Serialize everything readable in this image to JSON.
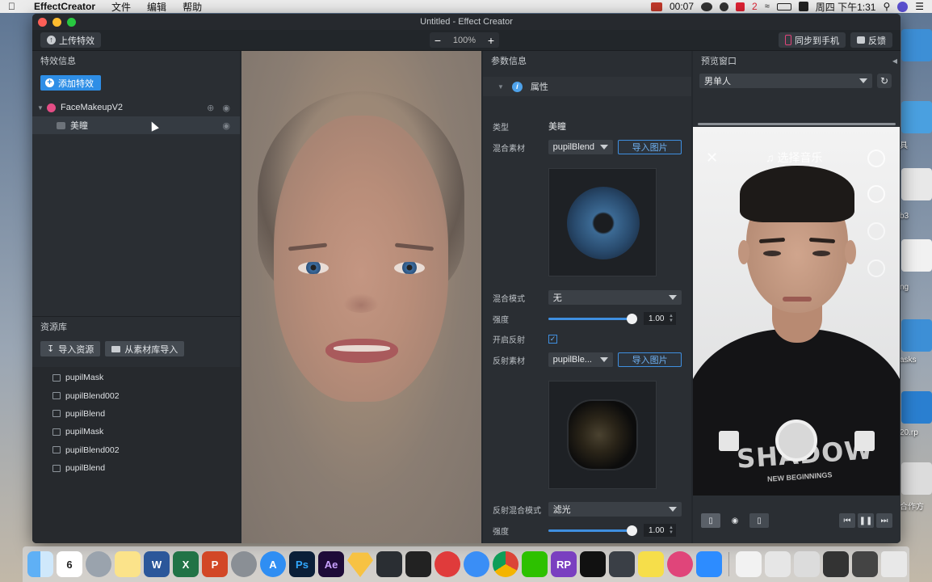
{
  "menubar": {
    "app_name": "EffectCreator",
    "menus": [
      "文件",
      "编辑",
      "帮助"
    ],
    "time": "00:07",
    "badge": "2",
    "datetime": "周四 下午1:31"
  },
  "window": {
    "title": "Untitled - Effect Creator"
  },
  "toolbar": {
    "upload_label": "上传特效",
    "zoom_minus": "−",
    "zoom_value": "100%",
    "zoom_plus": "+",
    "sync_label": "同步到手机",
    "feedback_label": "反馈"
  },
  "effects_panel": {
    "title": "特效信息",
    "add_label": "添加特效",
    "tree": {
      "root_label": "FaceMakeupV2",
      "child_label": "美瞳"
    }
  },
  "resources": {
    "title": "资源库",
    "import_label": "导入资源",
    "library_import_label": "从素材库导入",
    "items": [
      "pupilMask",
      "pupilBlend002",
      "pupilBlend",
      "pupilMask",
      "pupilBlend002",
      "pupilBlend"
    ]
  },
  "params": {
    "title": "参数信息",
    "section_label": "属性",
    "type_label": "类型",
    "type_value": "美瞳",
    "blend_material_label": "混合素材",
    "blend_material_value": "pupilBlend",
    "import_image_label": "导入图片",
    "blend_mode_label": "混合模式",
    "blend_mode_value": "无",
    "intensity_label": "强度",
    "intensity_value": "1.00",
    "intensity_fraction": 1.0,
    "reflect_enable_label": "开启反射",
    "reflect_enabled": true,
    "reflect_material_label": "反射素材",
    "reflect_material_value": "pupilBle...",
    "reflect_import_label": "导入图片",
    "reflect_blend_mode_label": "反射混合模式",
    "reflect_blend_mode_value": "滤光",
    "reflect_intensity_label": "强度",
    "reflect_intensity_value": "1.00",
    "reflect_intensity_fraction": 1.0
  },
  "preview": {
    "title": "预览窗口",
    "model_value": "男单人",
    "music_label": "选择音乐",
    "shirt_text": "SHADOW",
    "shirt_subtext": "NEW BEGINNINGS"
  },
  "desktop_labels": [
    "具",
    "b3",
    "ng",
    "asks",
    "20.rp",
    "合作方"
  ],
  "colors": {
    "accent": "#2e8ee6",
    "panel": "#2a2e33",
    "window_bg": "#24282d"
  }
}
